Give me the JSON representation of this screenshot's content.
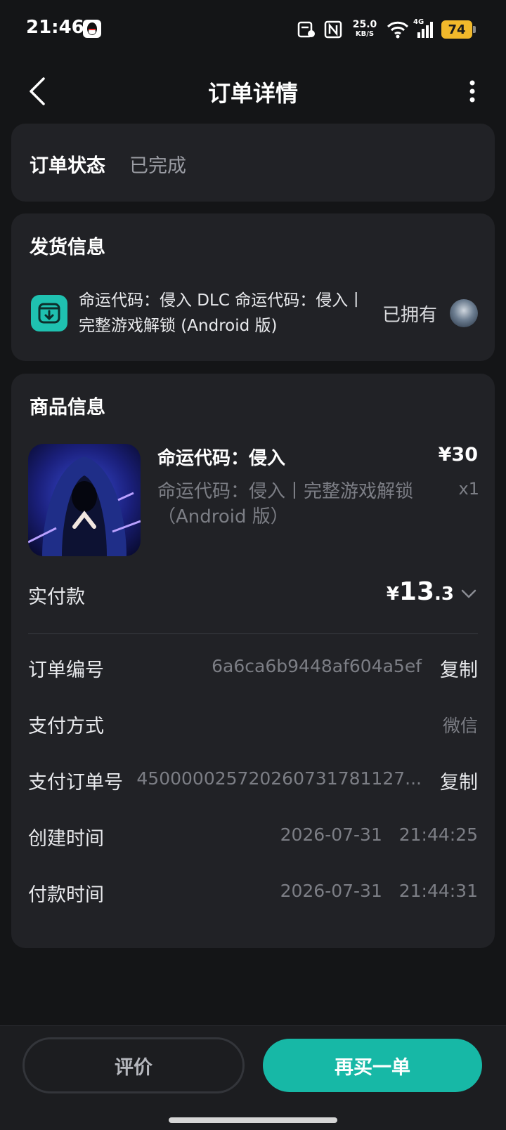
{
  "status_bar": {
    "time": "21:46",
    "net_speed_value": "25.0",
    "net_speed_unit": "KB/S",
    "signal_label": "4G",
    "battery": "74"
  },
  "header": {
    "title": "订单详情"
  },
  "order_status": {
    "label": "订单状态",
    "value": "已完成"
  },
  "shipping": {
    "title": "发货信息",
    "item_name": "命运代码：侵入 DLC 命运代码：侵入丨完整游戏解锁 (Android 版)",
    "owned_label": "已拥有"
  },
  "goods": {
    "title": "商品信息",
    "name": "命运代码：侵入",
    "price": "¥30",
    "sku": "命运代码：侵入丨完整游戏解锁（Android 版）",
    "quantity": "x1",
    "paid_label": "实付款",
    "paid_currency": "¥",
    "paid_integer": "13",
    "paid_decimal": ".3"
  },
  "details": {
    "order_no_label": "订单编号",
    "order_no": "6a6ca6b9448af604a5ef",
    "copy_label": "复制",
    "pay_method_label": "支付方式",
    "pay_method": "微信",
    "pay_order_label": "支付订单号",
    "pay_order_no": "45000002572026073178112​7...",
    "created_label": "创建时间",
    "created_time": "2026-07-31   21:44:25",
    "paid_time_label": "付款时间",
    "paid_time": "2026-07-31   21:44:31"
  },
  "actions": {
    "review": "评价",
    "rebuy": "再买一单"
  },
  "colors": {
    "background": "#141517",
    "card": "#212226",
    "accent": "#17b8a6",
    "battery": "#f2b92b"
  },
  "icons": [
    "back-icon",
    "more-icon",
    "download-box-icon",
    "chevron-down-icon",
    "wifi-icon",
    "nfc-icon",
    "signal-icon"
  ]
}
